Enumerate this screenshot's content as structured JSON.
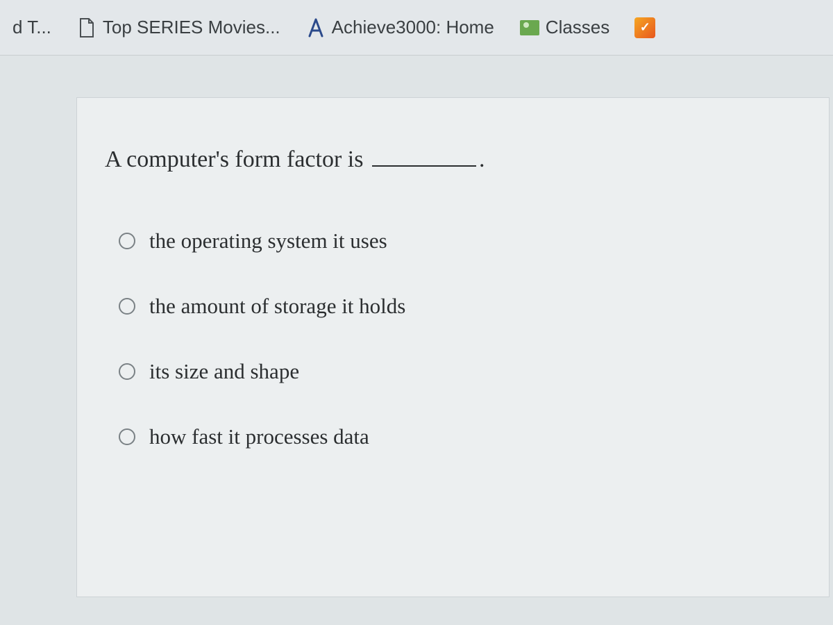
{
  "bookmarks": {
    "items": [
      {
        "label": "d T...",
        "icon": "none"
      },
      {
        "label": "Top SERIES Movies...",
        "icon": "file"
      },
      {
        "label": "Achieve3000: Home",
        "icon": "letter-a"
      },
      {
        "label": "Classes",
        "icon": "green-box"
      },
      {
        "label": "",
        "icon": "orange-box"
      }
    ]
  },
  "question": {
    "prompt_before": "A computer's form factor is ",
    "prompt_after": ".",
    "options": [
      "the operating system it uses",
      "the amount of storage it holds",
      "its size and shape",
      "how fast it processes data"
    ]
  }
}
